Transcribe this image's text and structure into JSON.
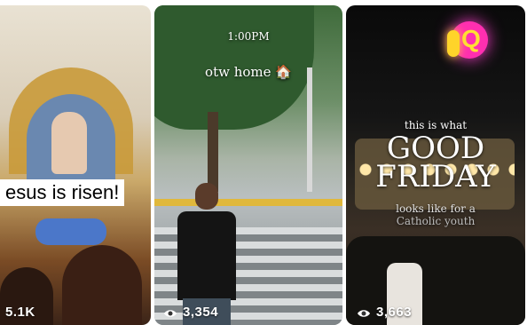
{
  "videos": [
    {
      "caption": "esus is risen!",
      "views": "5.1K"
    },
    {
      "time": "1:00PM",
      "caption": "otw home 🏠",
      "views": "3,354"
    },
    {
      "line1": "this is what",
      "title": "GOOD FRIDAY",
      "line3": "looks like for a",
      "line4": "Catholic youth",
      "logo_text": "Q",
      "views": "3,663"
    }
  ]
}
